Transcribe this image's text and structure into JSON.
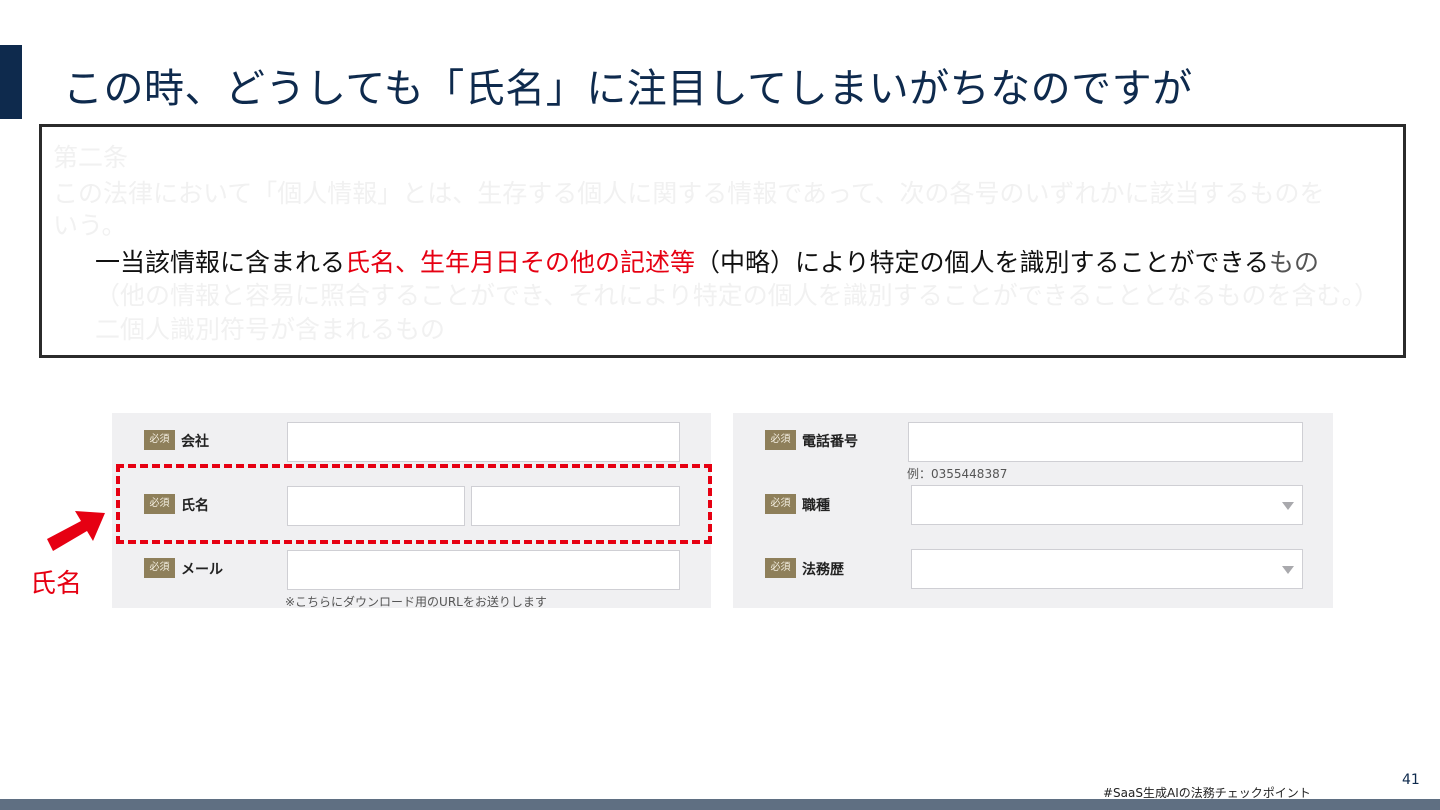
{
  "slide": {
    "title": "この時、どうしても「氏名」に注目してしまいがちなのですが",
    "page_number": "41",
    "hashtag": "#SaaS生成AIの法務チェックポイント"
  },
  "law_excerpt": {
    "article": "第二条",
    "line1": "この法律において「個人情報」とは、生存する個人に関する情報であって、次の各号のいずれかに該当するものを",
    "line2": "いう。",
    "item1_prefix": "一当該情報に含まれる",
    "item1_highlight": "氏名、生年月日その他の記述等",
    "item1_suffix": "（中略）により特定の個人を識別することができる",
    "item1_tail": "もの",
    "item1_paren": "（他の情報と容易に照合することができ、それにより特定の個人を識別することができることとなるものを含む。）",
    "item2": "二個人識別符号が含まれるもの"
  },
  "form": {
    "required_badge": "必須",
    "left": {
      "company_label": "会社",
      "name_label": "氏名",
      "email_label": "メール",
      "email_note": "※こちらにダウンロード用のURLをお送りします"
    },
    "right": {
      "phone_label": "電話番号",
      "phone_hint": "例：0355448387",
      "job_label": "職種",
      "legal_exp_label": "法務歴"
    }
  },
  "callout": {
    "label": "氏名"
  },
  "colors": {
    "navy": "#0e2a4d",
    "highlight_red": "#e60012",
    "badge_gold": "#8e7f5a",
    "panel_gray": "#f0f0f2"
  }
}
